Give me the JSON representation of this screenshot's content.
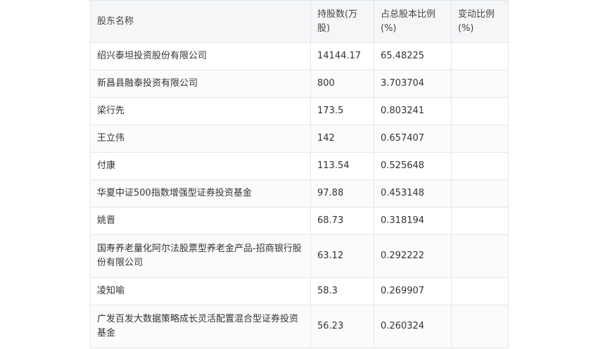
{
  "table": {
    "headers": [
      "股东名称",
      "持股数(万股)",
      "占总股本比例(%)",
      "变动比例(%)"
    ],
    "rows": [
      {
        "name": "绍兴泰坦投资股份有限公司",
        "shares": "14144.17",
        "ratio": "65.48225",
        "change": ""
      },
      {
        "name": "新昌县融泰投资有限公司",
        "shares": "800",
        "ratio": "3.703704",
        "change": ""
      },
      {
        "name": "梁行先",
        "shares": "173.5",
        "ratio": "0.803241",
        "change": ""
      },
      {
        "name": "王立伟",
        "shares": "142",
        "ratio": "0.657407",
        "change": ""
      },
      {
        "name": "付康",
        "shares": "113.54",
        "ratio": "0.525648",
        "change": ""
      },
      {
        "name": "华夏中证500指数增强型证券投资基金",
        "shares": "97.88",
        "ratio": "0.453148",
        "change": ""
      },
      {
        "name": "姚晋",
        "shares": "68.73",
        "ratio": "0.318194",
        "change": ""
      },
      {
        "name": "国寿养老量化阿尔法股票型养老金产品-招商银行股份有限公司",
        "shares": "63.12",
        "ratio": "0.292222",
        "change": ""
      },
      {
        "name": "凌知喻",
        "shares": "58.3",
        "ratio": "0.269907",
        "change": ""
      },
      {
        "name": "广发百发大数据策略成长灵活配置混合型证券投资基金",
        "shares": "56.23",
        "ratio": "0.260324",
        "change": ""
      }
    ]
  }
}
